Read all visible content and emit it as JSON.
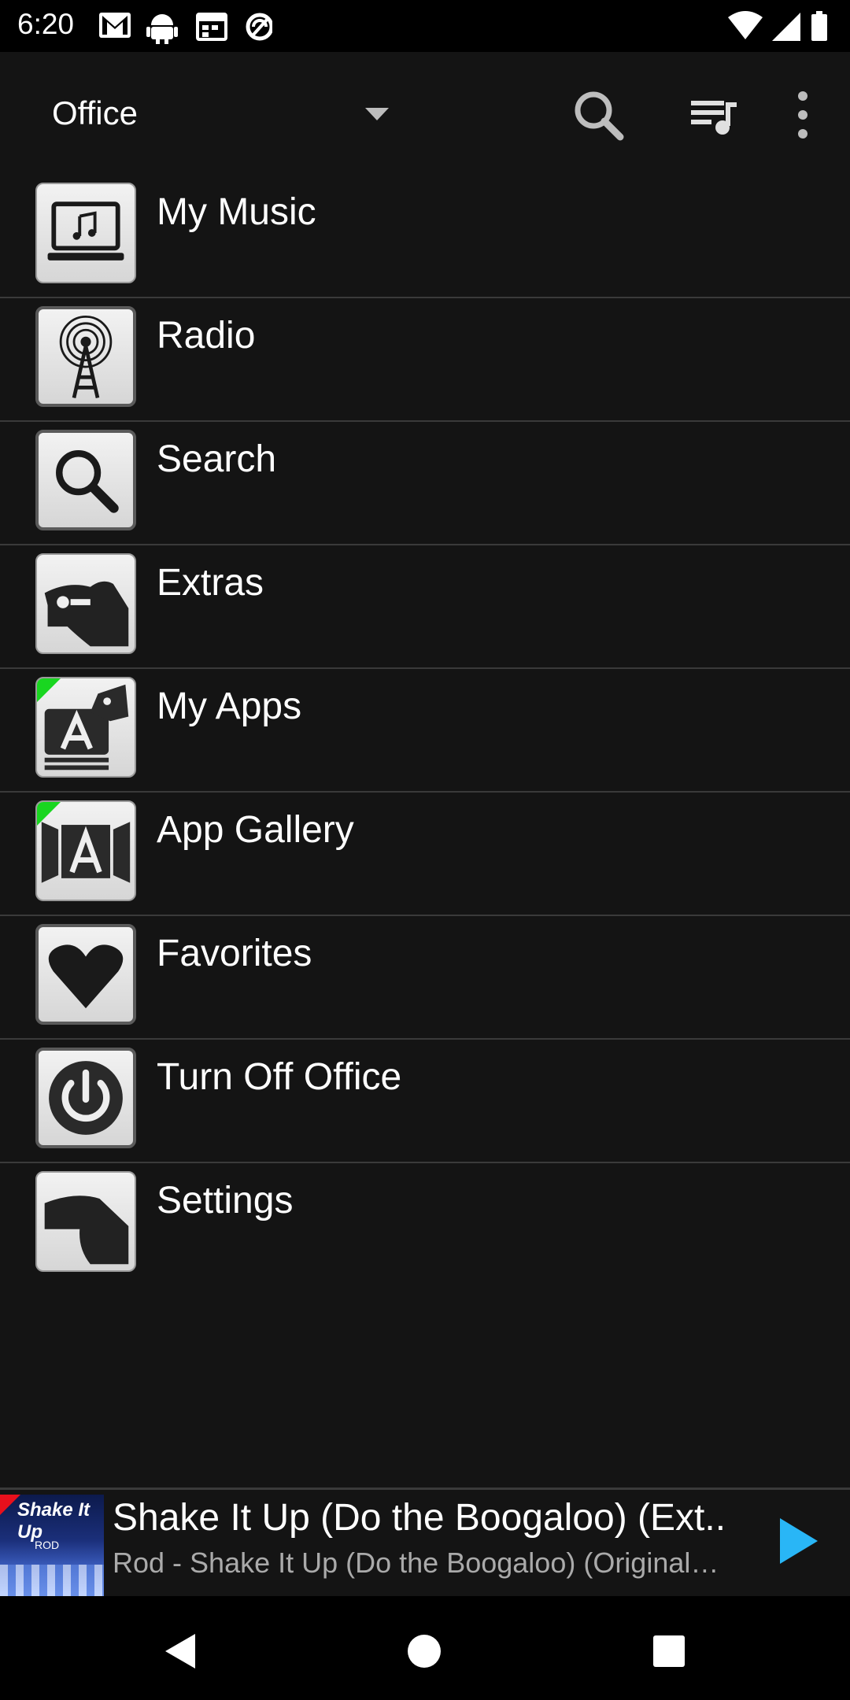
{
  "status_bar": {
    "time": "6:20",
    "left_icons": [
      "gmail-icon",
      "android-icon",
      "calendar-icon",
      "sync-icon"
    ],
    "right_icons": [
      "wifi-icon",
      "signal-icon",
      "battery-icon"
    ]
  },
  "toolbar": {
    "room_name": "Office",
    "icons": [
      "search-icon",
      "queue-icon",
      "more-vert-icon"
    ]
  },
  "menu": {
    "items": [
      {
        "label": "My Music",
        "icon": "laptop-music-icon"
      },
      {
        "label": "Radio",
        "icon": "radio-tower-icon"
      },
      {
        "label": "Search",
        "icon": "magnifier-icon"
      },
      {
        "label": "Extras",
        "icon": "hand-icon"
      },
      {
        "label": "My Apps",
        "icon": "apps-icon",
        "badge": "new"
      },
      {
        "label": "App Gallery",
        "icon": "gallery-icon",
        "badge": "new"
      },
      {
        "label": "Favorites",
        "icon": "heart-icon"
      },
      {
        "label": "Turn Off Office",
        "icon": "power-icon"
      },
      {
        "label": "Settings",
        "icon": "settings-hand-icon"
      }
    ]
  },
  "now_playing": {
    "title": "Shake It Up (Do the Boogaloo) (Ext..",
    "subtitle": "Rod - Shake It Up (Do the Boogaloo) (Original…",
    "art_title": "Shake It Up",
    "art_subtitle": "ROD",
    "play_color": "#29b6f6"
  },
  "nav_bar": {
    "icons": [
      "back-icon",
      "home-icon",
      "recents-icon"
    ]
  }
}
